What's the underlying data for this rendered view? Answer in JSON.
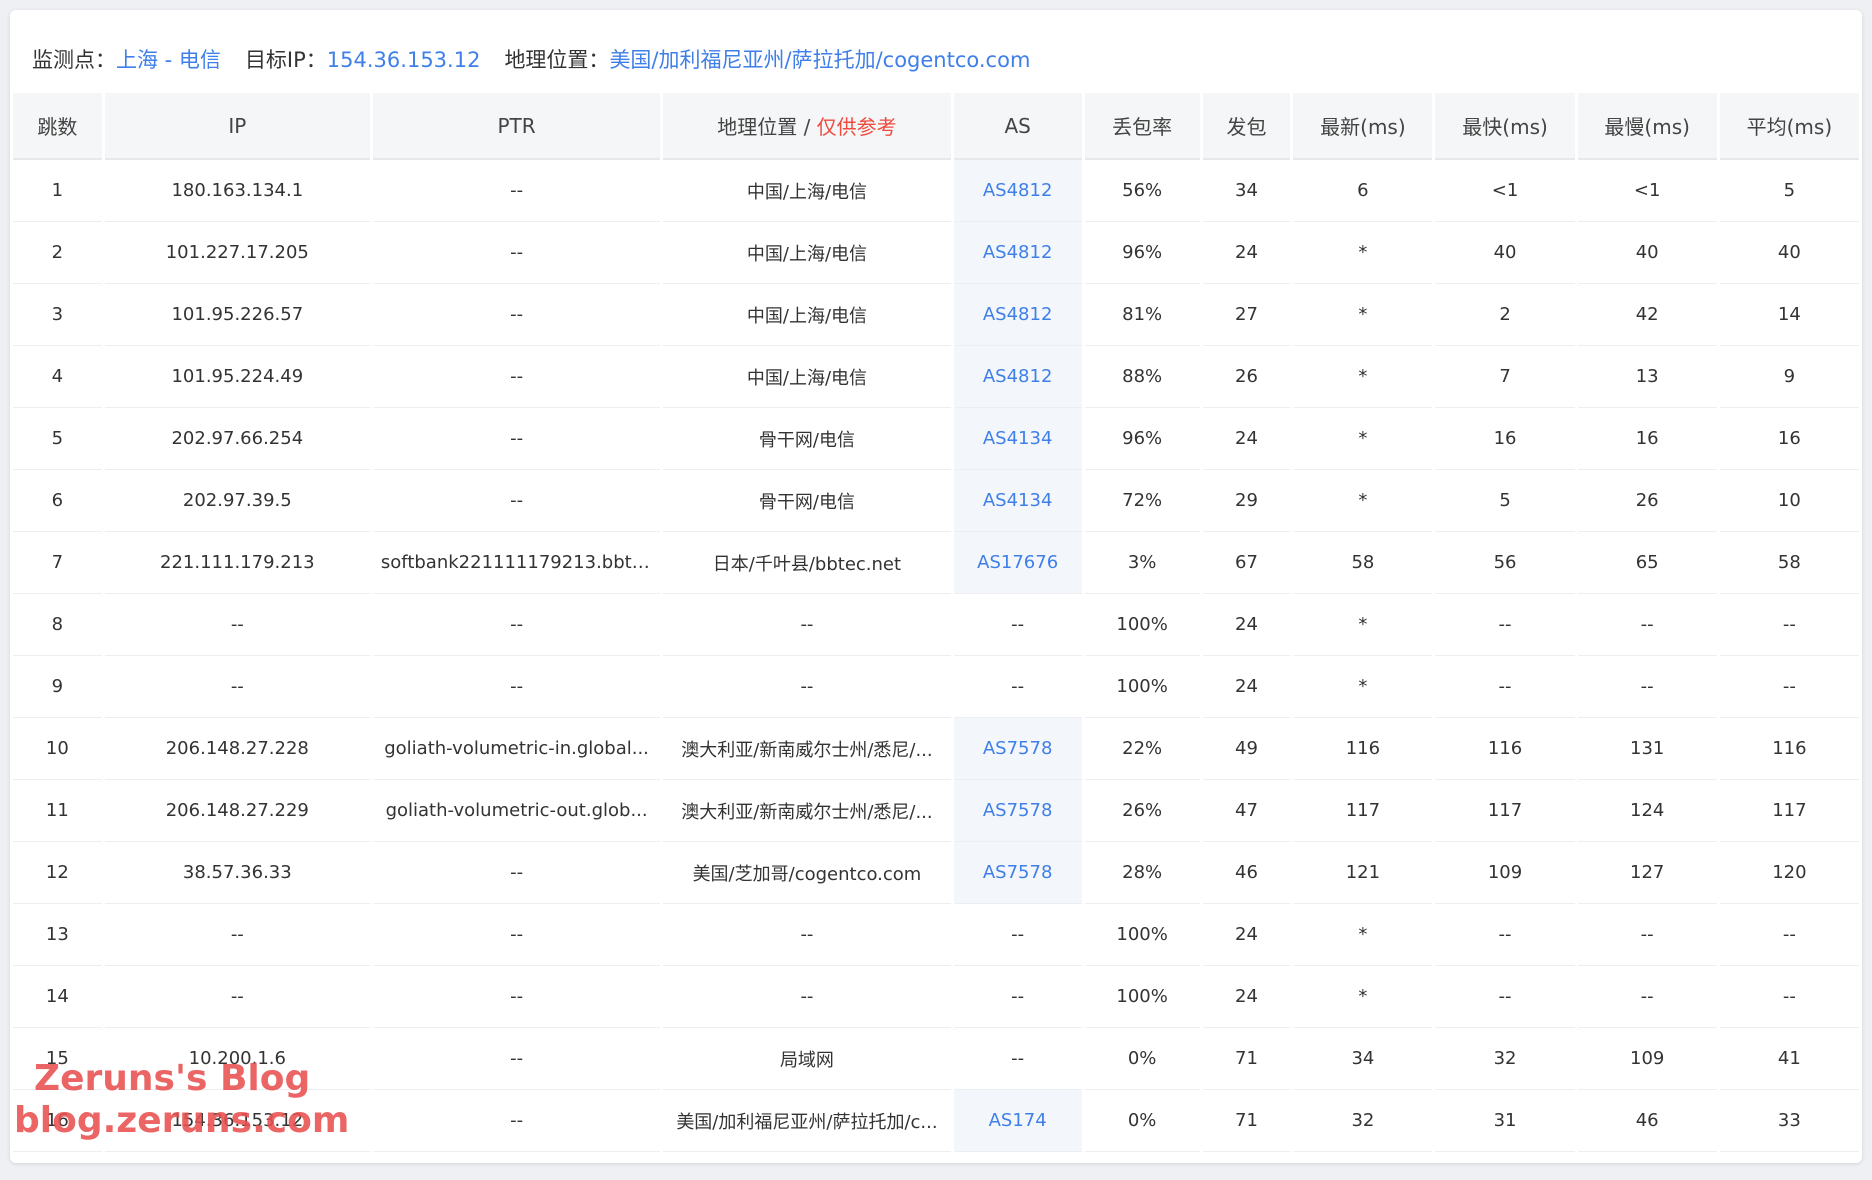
{
  "header": {
    "monitor_label": "监测点：",
    "monitor_value": "上海 - 电信",
    "target_label": "目标IP：",
    "target_value": "154.36.153.12",
    "geo_label": "地理位置：",
    "geo_value": "美国/加利福尼亚州/萨拉托加/cogentco.com"
  },
  "columns": {
    "hop": "跳数",
    "ip": "IP",
    "ptr": "PTR",
    "geo": "地理位置 / ",
    "geo_note": "仅供参考",
    "as": "AS",
    "loss": "丢包率",
    "sent": "发包",
    "last": "最新(ms)",
    "best": "最快(ms)",
    "worst": "最慢(ms)",
    "avg": "平均(ms)"
  },
  "rows": [
    {
      "hop": "1",
      "ip": "180.163.134.1",
      "ptr": "--",
      "geo": "中国/上海/电信",
      "as": "AS4812",
      "loss": "56%",
      "sent": "34",
      "last": "6",
      "best": "<1",
      "worst": "<1",
      "avg": "5"
    },
    {
      "hop": "2",
      "ip": "101.227.17.205",
      "ptr": "--",
      "geo": "中国/上海/电信",
      "as": "AS4812",
      "loss": "96%",
      "sent": "24",
      "last": "*",
      "best": "40",
      "worst": "40",
      "avg": "40"
    },
    {
      "hop": "3",
      "ip": "101.95.226.57",
      "ptr": "--",
      "geo": "中国/上海/电信",
      "as": "AS4812",
      "loss": "81%",
      "sent": "27",
      "last": "*",
      "best": "2",
      "worst": "42",
      "avg": "14"
    },
    {
      "hop": "4",
      "ip": "101.95.224.49",
      "ptr": "--",
      "geo": "中国/上海/电信",
      "as": "AS4812",
      "loss": "88%",
      "sent": "26",
      "last": "*",
      "best": "7",
      "worst": "13",
      "avg": "9"
    },
    {
      "hop": "5",
      "ip": "202.97.66.254",
      "ptr": "--",
      "geo": "骨干网/电信",
      "as": "AS4134",
      "loss": "96%",
      "sent": "24",
      "last": "*",
      "best": "16",
      "worst": "16",
      "avg": "16"
    },
    {
      "hop": "6",
      "ip": "202.97.39.5",
      "ptr": "--",
      "geo": "骨干网/电信",
      "as": "AS4134",
      "loss": "72%",
      "sent": "29",
      "last": "*",
      "best": "5",
      "worst": "26",
      "avg": "10"
    },
    {
      "hop": "7",
      "ip": "221.111.179.213",
      "ptr": "softbank221111179213.bbte...",
      "geo": "日本/千叶县/bbtec.net",
      "as": "AS17676",
      "loss": "3%",
      "sent": "67",
      "last": "58",
      "best": "56",
      "worst": "65",
      "avg": "58"
    },
    {
      "hop": "8",
      "ip": "--",
      "ptr": "--",
      "geo": "--",
      "as": "--",
      "loss": "100%",
      "sent": "24",
      "last": "*",
      "best": "--",
      "worst": "--",
      "avg": "--"
    },
    {
      "hop": "9",
      "ip": "--",
      "ptr": "--",
      "geo": "--",
      "as": "--",
      "loss": "100%",
      "sent": "24",
      "last": "*",
      "best": "--",
      "worst": "--",
      "avg": "--"
    },
    {
      "hop": "10",
      "ip": "206.148.27.228",
      "ptr": "goliath-volumetric-in.global...",
      "geo": "澳大利亚/新南威尔士州/悉尼/...",
      "as": "AS7578",
      "loss": "22%",
      "sent": "49",
      "last": "116",
      "best": "116",
      "worst": "131",
      "avg": "116"
    },
    {
      "hop": "11",
      "ip": "206.148.27.229",
      "ptr": "goliath-volumetric-out.glob...",
      "geo": "澳大利亚/新南威尔士州/悉尼/...",
      "as": "AS7578",
      "loss": "26%",
      "sent": "47",
      "last": "117",
      "best": "117",
      "worst": "124",
      "avg": "117"
    },
    {
      "hop": "12",
      "ip": "38.57.36.33",
      "ptr": "--",
      "geo": "美国/芝加哥/cogentco.com",
      "as": "AS7578",
      "loss": "28%",
      "sent": "46",
      "last": "121",
      "best": "109",
      "worst": "127",
      "avg": "120"
    },
    {
      "hop": "13",
      "ip": "--",
      "ptr": "--",
      "geo": "--",
      "as": "--",
      "loss": "100%",
      "sent": "24",
      "last": "*",
      "best": "--",
      "worst": "--",
      "avg": "--"
    },
    {
      "hop": "14",
      "ip": "--",
      "ptr": "--",
      "geo": "--",
      "as": "--",
      "loss": "100%",
      "sent": "24",
      "last": "*",
      "best": "--",
      "worst": "--",
      "avg": "--"
    },
    {
      "hop": "15",
      "ip": "10.200.1.6",
      "ptr": "--",
      "geo": "局域网",
      "as": "--",
      "loss": "0%",
      "sent": "71",
      "last": "34",
      "best": "32",
      "worst": "109",
      "avg": "41"
    },
    {
      "hop": "16",
      "ip": "154.36.153.12",
      "ptr": "--",
      "geo": "美国/加利福尼亚州/萨拉托加/c...",
      "as": "AS174",
      "loss": "0%",
      "sent": "71",
      "last": "32",
      "best": "31",
      "worst": "46",
      "avg": "33"
    }
  ],
  "watermark": {
    "line1": "Zeruns's Blog",
    "line2": "blog.zeruns.com"
  },
  "colors": {
    "link": "#3f7fe8",
    "note_red": "#ef4b3f",
    "header_bg": "#f5f6f7",
    "as_cell_bg": "#f3f6fa",
    "watermark": "#e85050"
  }
}
